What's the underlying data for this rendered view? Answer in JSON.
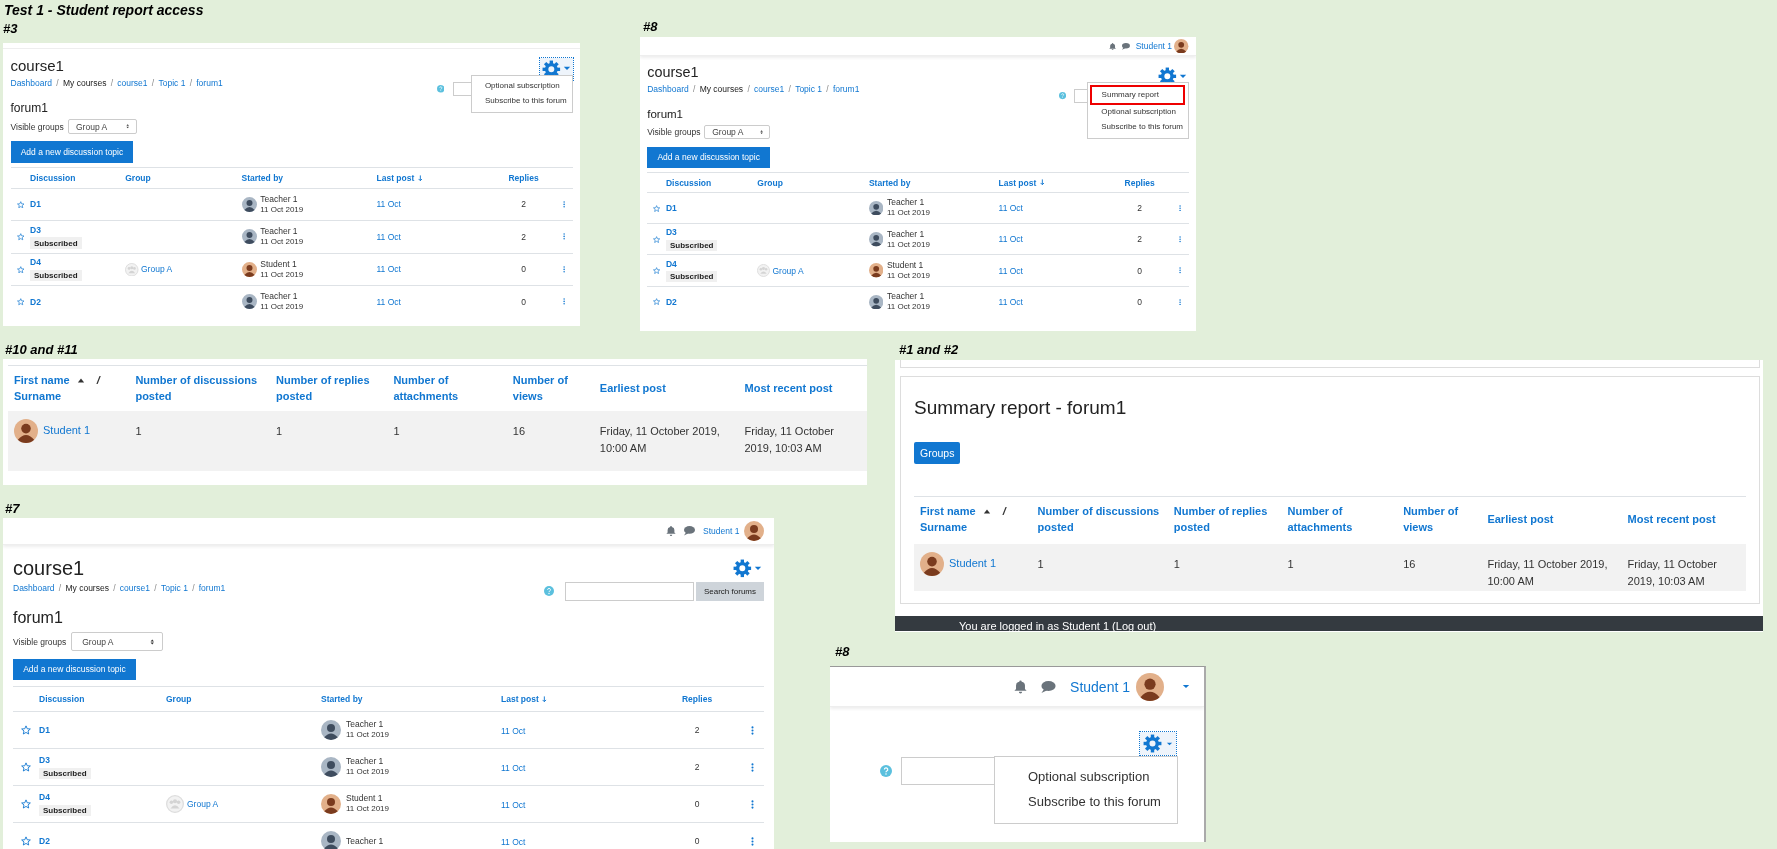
{
  "heading": "Test 1 - Student report access",
  "panels": [
    {
      "kind": "forum",
      "label": "#3",
      "course": "course1",
      "breadcrumb": [
        {
          "text": "Dashboard",
          "link": true
        },
        {
          "sep": "/",
          "text": "My courses",
          "link": false
        },
        {
          "sep": "/",
          "text": "course1",
          "link": true
        },
        {
          "sep": "/",
          "text": "Topic 1",
          "link": true
        },
        {
          "sep": "/",
          "text": "forum1",
          "link": true
        }
      ],
      "settings": {
        "focused": true,
        "menu": [
          {
            "label": "Optional subscription",
            "annotated": false
          },
          {
            "label": "Subscribe to this forum",
            "annotated": false
          }
        ]
      },
      "forum": "forum1",
      "groups_label": "Visible groups",
      "groups_value": "Group A",
      "add_button": "Add a new discussion topic",
      "columns": [
        {
          "label": "Discussion",
          "sorted": false
        },
        {
          "label": "Group",
          "sorted": false
        },
        {
          "label": "Started by",
          "sorted": false
        },
        {
          "label": "Last post",
          "sorted": true
        },
        {
          "label": "Replies",
          "sorted": false
        }
      ],
      "rows": [
        {
          "kind": "teacher",
          "title": "D1",
          "author": "Teacher 1",
          "date": "11 Oct 2019",
          "last_post": "11 Oct",
          "replies": "2"
        },
        {
          "kind": "teacher",
          "title": "D3",
          "badge": "Subscribed",
          "author": "Teacher 1",
          "date": "11 Oct 2019",
          "last_post": "11 Oct",
          "replies": "2"
        },
        {
          "kind": "student",
          "title": "D4",
          "badge": "Subscribed",
          "group": "Group A",
          "author": "Student 1",
          "date": "11 Oct 2019",
          "last_post": "11 Oct",
          "replies": "0"
        },
        {
          "kind": "teacher",
          "title": "D2",
          "author": "Teacher 1",
          "date": "11 Oct 2019",
          "last_post": "11 Oct",
          "replies": "0"
        }
      ]
    },
    {
      "kind": "forum",
      "label": "#8",
      "navbar": {
        "user": "Student 1"
      },
      "course": "course1",
      "breadcrumb": [
        {
          "text": "Dashboard",
          "link": true
        },
        {
          "sep": "/",
          "text": "My courses",
          "link": false
        },
        {
          "sep": "/",
          "text": "course1",
          "link": true
        },
        {
          "sep": "/",
          "text": "Topic 1",
          "link": true
        },
        {
          "sep": "/",
          "text": "forum1",
          "link": true
        }
      ],
      "settings": {
        "focused": false,
        "menu": [
          {
            "label": "Summary report",
            "annotated": true
          },
          {
            "label": "Optional subscription",
            "annotated": false
          },
          {
            "label": "Subscribe to this forum",
            "annotated": false
          }
        ]
      },
      "forum": "forum1",
      "groups_label": "Visible groups",
      "groups_value": "Group A",
      "add_button": "Add a new discussion topic",
      "columns": [
        {
          "label": "Discussion",
          "sorted": false
        },
        {
          "label": "Group",
          "sorted": false
        },
        {
          "label": "Started by",
          "sorted": false
        },
        {
          "label": "Last post",
          "sorted": true
        },
        {
          "label": "Replies",
          "sorted": false
        }
      ],
      "rows": [
        {
          "kind": "teacher",
          "title": "D1",
          "author": "Teacher 1",
          "date": "11 Oct 2019",
          "last_post": "11 Oct",
          "replies": "2"
        },
        {
          "kind": "teacher",
          "title": "D3",
          "badge": "Subscribed",
          "author": "Teacher 1",
          "date": "11 Oct 2019",
          "last_post": "11 Oct",
          "replies": "2"
        },
        {
          "kind": "student",
          "title": "D4",
          "badge": "Subscribed",
          "group": "Group A",
          "author": "Student 1",
          "date": "11 Oct 2019",
          "last_post": "11 Oct",
          "replies": "0"
        },
        {
          "kind": "teacher",
          "title": "D2",
          "author": "Teacher 1",
          "date": "11 Oct 2019",
          "last_post": "11 Oct",
          "replies": "0"
        }
      ]
    },
    {
      "kind": "report",
      "label": "#10 and #11",
      "columns": [
        {
          "label": "First name",
          "sorted": true,
          "separator": "/",
          "label_2": "Surname"
        },
        {
          "label": "Number of discussions posted",
          "sorted": false
        },
        {
          "label": "Number of replies posted",
          "sorted": false
        },
        {
          "label": "Number of attachments",
          "sorted": false
        },
        {
          "label": "Number of views",
          "sorted": false
        },
        {
          "label": "Earliest post",
          "sorted": false
        },
        {
          "label": "Most recent post",
          "sorted": false
        }
      ],
      "rows": [
        {
          "kind": "student",
          "user": "Student 1",
          "values": [
            "1",
            "1",
            "1",
            "16",
            "Friday, 11 October 2019, 10:00 AM",
            "Friday, 11 October 2019, 10:03 AM"
          ]
        }
      ]
    },
    {
      "kind": "report",
      "label": "#1 and #2",
      "title": "Summary report - forum1",
      "filter_button": "Groups",
      "columns": [
        {
          "label": "First name",
          "sorted": true,
          "separator": "/",
          "label_2": "Surname"
        },
        {
          "label": "Number of discussions posted",
          "sorted": false
        },
        {
          "label": "Number of replies posted",
          "sorted": false
        },
        {
          "label": "Number of attachments",
          "sorted": false
        },
        {
          "label": "Number of views",
          "sorted": false
        },
        {
          "label": "Earliest post",
          "sorted": false
        },
        {
          "label": "Most recent post",
          "sorted": false
        }
      ],
      "rows": [
        {
          "kind": "student",
          "user": "Student 1",
          "values": [
            "1",
            "1",
            "1",
            "16",
            "Friday, 11 October 2019, 10:00 AM",
            "Friday, 11 October 2019, 10:03 AM"
          ]
        }
      ],
      "footer": "You are logged in as Student 1 (Log out)"
    },
    {
      "kind": "forum",
      "label": "#7",
      "navbar": {
        "user": "Student 1"
      },
      "course": "course1",
      "breadcrumb": [
        {
          "text": "Dashboard",
          "link": true
        },
        {
          "sep": "/",
          "text": "My courses",
          "link": false
        },
        {
          "sep": "/",
          "text": "course1",
          "link": true
        },
        {
          "sep": "/",
          "text": "Topic 1",
          "link": true
        },
        {
          "sep": "/",
          "text": "forum1",
          "link": true
        }
      ],
      "settings": {
        "focused": false
      },
      "search_button": "Search forums",
      "forum": "forum1",
      "groups_label": "Visible groups",
      "groups_value": "Group A",
      "add_button": "Add a new discussion topic",
      "columns": [
        {
          "label": "Discussion",
          "sorted": false
        },
        {
          "label": "Group",
          "sorted": false
        },
        {
          "label": "Started by",
          "sorted": false
        },
        {
          "label": "Last post",
          "sorted": true
        },
        {
          "label": "Replies",
          "sorted": false
        }
      ],
      "rows": [
        {
          "kind": "teacher",
          "title": "D1",
          "author": "Teacher 1",
          "date": "11 Oct 2019",
          "last_post": "11 Oct",
          "replies": "2"
        },
        {
          "kind": "teacher",
          "title": "D3",
          "badge": "Subscribed",
          "author": "Teacher 1",
          "date": "11 Oct 2019",
          "last_post": "11 Oct",
          "replies": "2"
        },
        {
          "kind": "student",
          "title": "D4",
          "badge": "Subscribed",
          "group": "Group A",
          "author": "Student 1",
          "date": "11 Oct 2019",
          "last_post": "11 Oct",
          "replies": "0"
        },
        {
          "kind": "teacher",
          "title": "D2",
          "author": "Teacher 1",
          "last_post": "11 Oct",
          "replies": "0"
        }
      ]
    },
    {
      "kind": "closeup",
      "label": "#8",
      "navbar": {
        "user": "Student 1"
      },
      "settings": {
        "focused": true,
        "menu": [
          {
            "label": "Optional subscription",
            "annotated": false
          },
          {
            "label": "Subscribe to this forum",
            "annotated": false
          }
        ]
      }
    }
  ]
}
